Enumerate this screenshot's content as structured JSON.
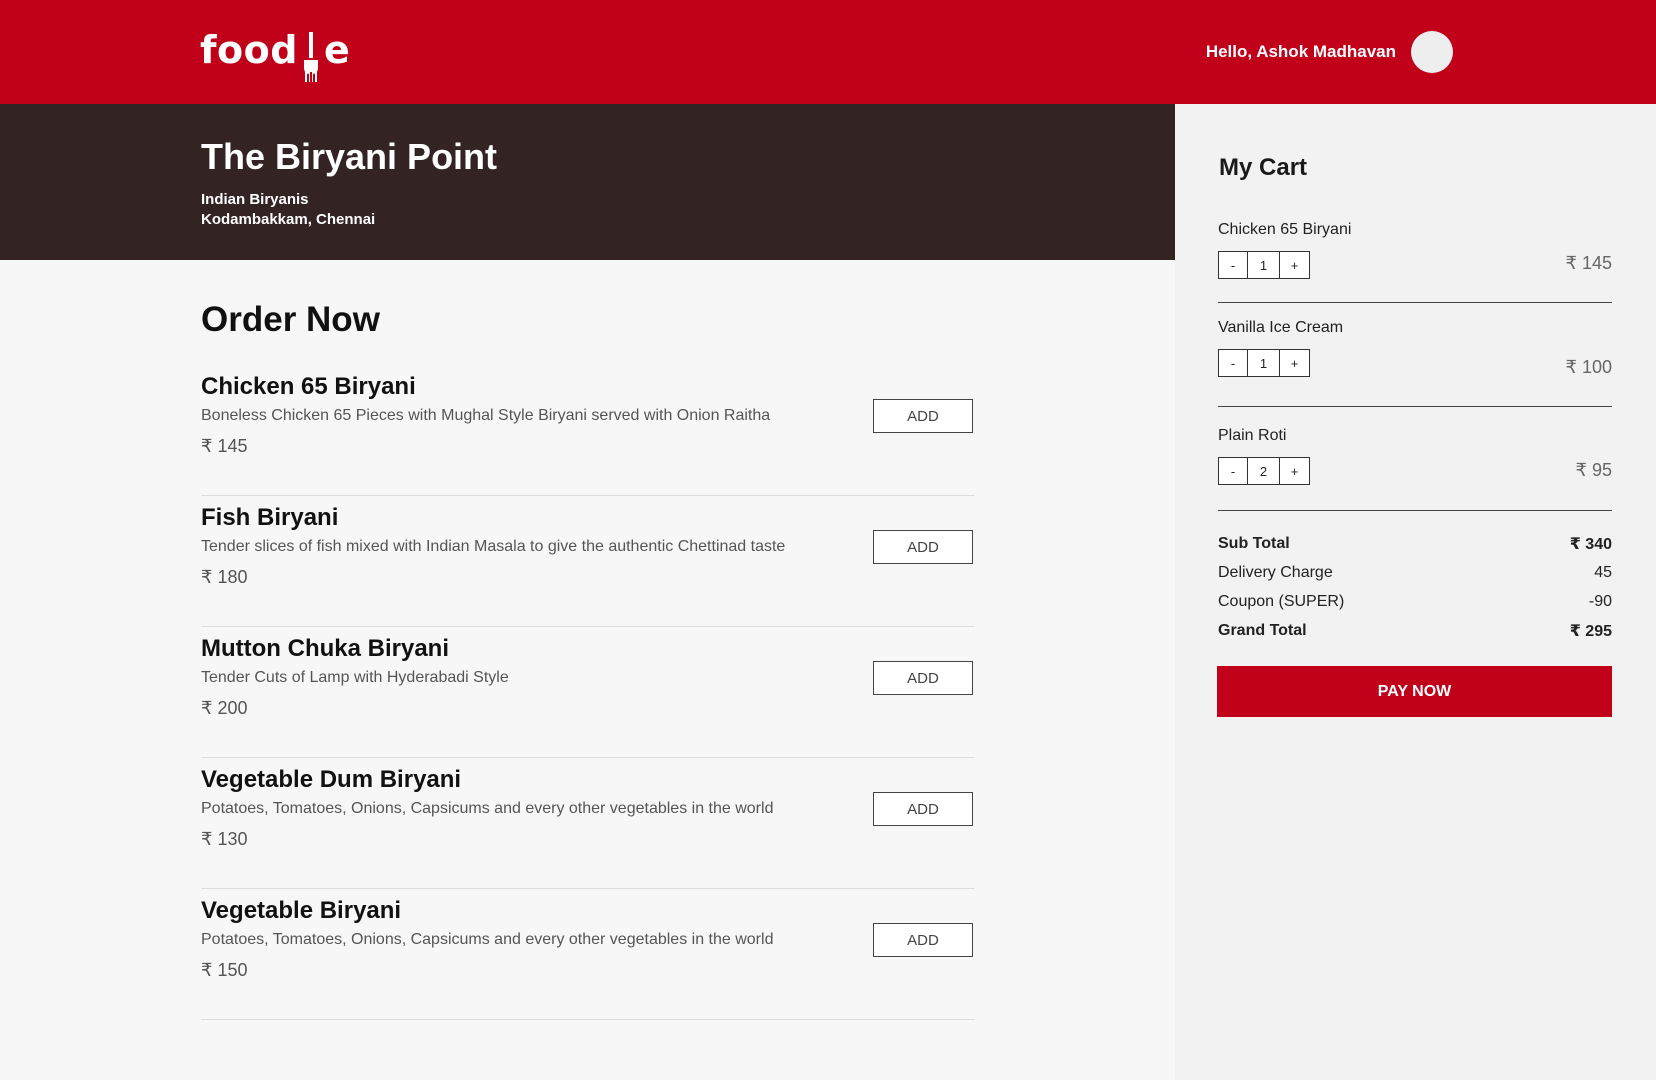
{
  "header": {
    "logo_text_before": "food",
    "logo_text_after": "e",
    "greeting": "Hello, Ashok Madhavan",
    "brand_color": "#c1001a"
  },
  "restaurant": {
    "name": "The Biryani Point",
    "cuisine": "Indian Biryanis",
    "location": "Kodambakkam, Chennai"
  },
  "menu": {
    "title": "Order Now",
    "add_label": "ADD",
    "items": [
      {
        "name": "Chicken 65 Biryani",
        "description": "Boneless Chicken 65 Pieces with Mughal Style Biryani served with Onion Raitha",
        "price": "₹ 145"
      },
      {
        "name": "Fish Biryani",
        "description": "Tender slices of fish mixed with Indian Masala to give the authentic Chettinad taste",
        "price": "₹ 180"
      },
      {
        "name": "Mutton Chuka Biryani",
        "description": "Tender Cuts of Lamp with Hyderabadi Style",
        "price": "₹ 200"
      },
      {
        "name": "Vegetable Dum Biryani",
        "description": "Potatoes, Tomatoes, Onions, Capsicums and every other vegetables in the world",
        "price": "₹ 130"
      },
      {
        "name": "Vegetable Biryani",
        "description": "Potatoes, Tomatoes, Onions, Capsicums and every other vegetables in the world",
        "price": "₹ 150"
      }
    ]
  },
  "cart": {
    "title": "My Cart",
    "minus": "-",
    "plus": "+",
    "items": [
      {
        "name": "Chicken 65 Biryani",
        "qty": "1",
        "price": "₹ 145"
      },
      {
        "name": "Vanilla Ice Cream",
        "qty": "1",
        "price": "₹ 100"
      },
      {
        "name": "Plain Roti",
        "qty": "2",
        "price": "₹ 95"
      }
    ],
    "summary": {
      "subtotal_label": "Sub Total",
      "subtotal": "₹ 340",
      "delivery_label": "Delivery Charge",
      "delivery": "45",
      "coupon_label": "Coupon (SUPER)",
      "coupon": "-90",
      "grand_label": "Grand Total",
      "grand": "₹ 295"
    },
    "pay_label": "PAY NOW"
  }
}
